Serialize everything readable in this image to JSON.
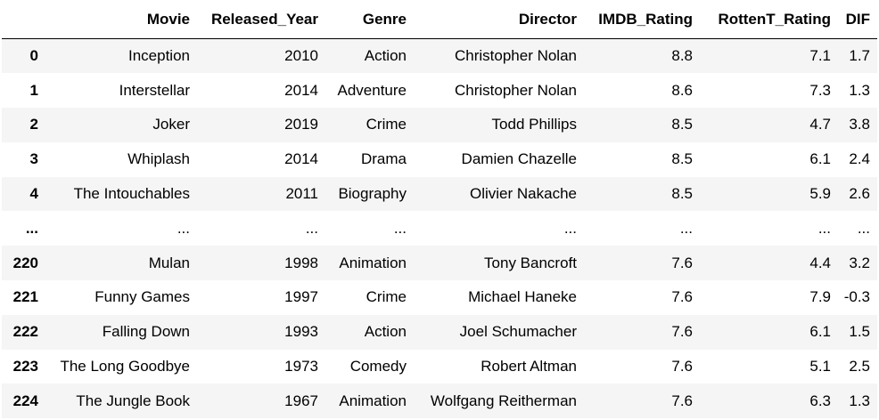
{
  "table": {
    "columns": [
      "",
      "Movie",
      "Released_Year",
      "Genre",
      "Director",
      "IMDB_Rating",
      "RottenT_Rating",
      "DIF"
    ],
    "rows": [
      {
        "index": "0",
        "cells": [
          "Inception",
          "2010",
          "Action",
          "Christopher Nolan",
          "8.8",
          "7.1",
          "1.7"
        ]
      },
      {
        "index": "1",
        "cells": [
          "Interstellar",
          "2014",
          "Adventure",
          "Christopher Nolan",
          "8.6",
          "7.3",
          "1.3"
        ]
      },
      {
        "index": "2",
        "cells": [
          "Joker",
          "2019",
          "Crime",
          "Todd Phillips",
          "8.5",
          "4.7",
          "3.8"
        ]
      },
      {
        "index": "3",
        "cells": [
          "Whiplash",
          "2014",
          "Drama",
          "Damien Chazelle",
          "8.5",
          "6.1",
          "2.4"
        ]
      },
      {
        "index": "4",
        "cells": [
          "The Intouchables",
          "2011",
          "Biography",
          "Olivier Nakache",
          "8.5",
          "5.9",
          "2.6"
        ]
      },
      {
        "index": "...",
        "cells": [
          "...",
          "...",
          "...",
          "...",
          "...",
          "...",
          "..."
        ]
      },
      {
        "index": "220",
        "cells": [
          "Mulan",
          "1998",
          "Animation",
          "Tony Bancroft",
          "7.6",
          "4.4",
          "3.2"
        ]
      },
      {
        "index": "221",
        "cells": [
          "Funny Games",
          "1997",
          "Crime",
          "Michael Haneke",
          "7.6",
          "7.9",
          "-0.3"
        ]
      },
      {
        "index": "222",
        "cells": [
          "Falling Down",
          "1993",
          "Action",
          "Joel Schumacher",
          "7.6",
          "6.1",
          "1.5"
        ]
      },
      {
        "index": "223",
        "cells": [
          "The Long Goodbye",
          "1973",
          "Comedy",
          "Robert Altman",
          "7.6",
          "5.1",
          "2.5"
        ]
      },
      {
        "index": "224",
        "cells": [
          "The Jungle Book",
          "1967",
          "Animation",
          "Wolfgang Reitherman",
          "7.6",
          "6.3",
          "1.3"
        ]
      }
    ]
  }
}
